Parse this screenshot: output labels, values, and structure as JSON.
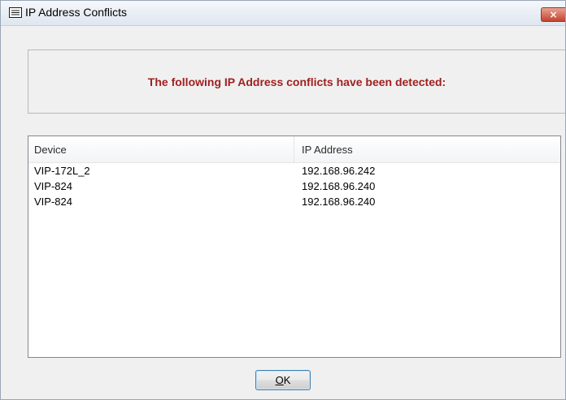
{
  "window": {
    "title": "IP Address Conflicts",
    "icon": "window-list-icon",
    "close_glyph": "×"
  },
  "message": {
    "text": "The following IP Address conflicts have been detected:",
    "color": "#a11f1f"
  },
  "table": {
    "columns": [
      "Device",
      "IP Address"
    ],
    "rows": [
      {
        "device": "VIP-172L_2",
        "ip": "192.168.96.242"
      },
      {
        "device": "VIP-824",
        "ip": "192.168.96.240"
      },
      {
        "device": "VIP-824",
        "ip": "192.168.96.240"
      }
    ]
  },
  "buttons": {
    "ok_accel": "O",
    "ok_rest": "K"
  }
}
